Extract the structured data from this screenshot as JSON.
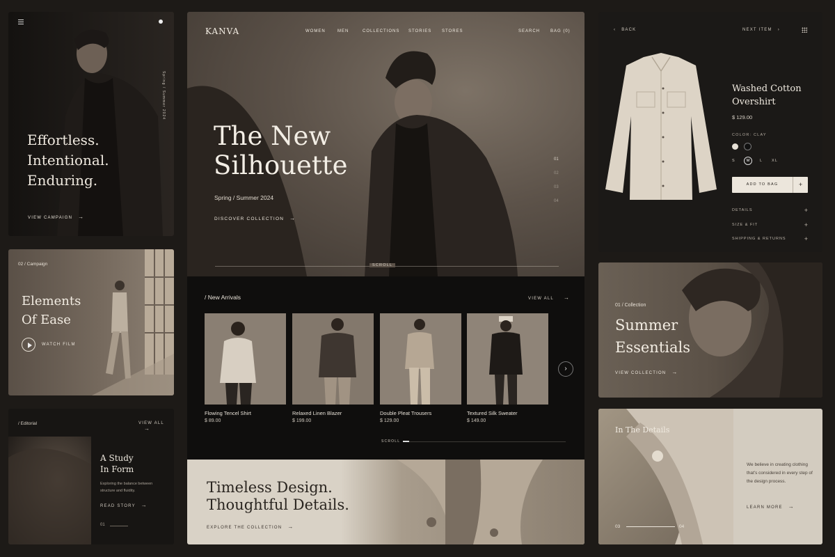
{
  "campaign": {
    "headline": [
      "Effortless.",
      "Intentional.",
      "Enduring."
    ],
    "vertical_text": "Spring / Summer 2024",
    "cta": "VIEW CAMPAIGN"
  },
  "ease": {
    "eyebrow": "02 / Campaign",
    "title": [
      "Elements",
      "Of Ease"
    ],
    "cta": "WATCH FILM"
  },
  "editorial": {
    "eyebrow": "/ Editorial",
    "view_all": "VIEW ALL",
    "title": [
      "A Study",
      "In Form"
    ],
    "body": "Exploring the balance between structure and fluidity.",
    "cta": "READ STORY",
    "index": "01"
  },
  "hero": {
    "brand": "KANVA",
    "nav": [
      "WOMEN",
      "MEN",
      "COLLECTIONS",
      "STORIES",
      "STORES"
    ],
    "search": "SEARCH",
    "bag": "BAG (0)",
    "title": [
      "The New",
      "Silhouette"
    ],
    "subtitle": "Spring / Summer 2024",
    "cta": "DISCOVER COLLECTION",
    "pager": [
      "01",
      "02",
      "03",
      "04"
    ],
    "scroll": "SCROLL"
  },
  "arrivals": {
    "title": "/  New Arrivals",
    "view_all": "VIEW ALL",
    "products": [
      {
        "name": "Flowing Tencel Shirt",
        "price": "$ 89.00"
      },
      {
        "name": "Relaxed Linen Blazer",
        "price": "$ 199.00"
      },
      {
        "name": "Double Pleat Trousers",
        "price": "$ 129.00"
      },
      {
        "name": "Textured Silk Sweater",
        "price": "$ 149.00"
      }
    ],
    "scroll": "SCROLL"
  },
  "timeless": {
    "title": [
      "Timeless Design.",
      "Thoughtful Details."
    ],
    "cta": "EXPLORE THE COLLECTION"
  },
  "product": {
    "back": "BACK",
    "next": "NEXT ITEM",
    "name": [
      "Washed Cotton",
      "Overshirt"
    ],
    "price": "$ 129.00",
    "color_label": "COLOR: CLAY",
    "sizes": [
      "S",
      "M",
      "L",
      "XL"
    ],
    "selected_size": "M",
    "add_to_bag": "ADD TO BAG",
    "accordion": [
      "DETAILS",
      "SIZE & FIT",
      "SHIPPING & RETURNS"
    ],
    "swatches": [
      "#e6e0d6",
      "#111111"
    ]
  },
  "summer": {
    "eyebrow": "01 / Collection",
    "title": [
      "Summer",
      "Essentials"
    ],
    "cta": "VIEW COLLECTION"
  },
  "details": {
    "title": "In The Details",
    "body": "We believe in creating clothing that's considered in every step of the design process.",
    "cta": "LEARN MORE",
    "from": "03",
    "to": "04"
  }
}
